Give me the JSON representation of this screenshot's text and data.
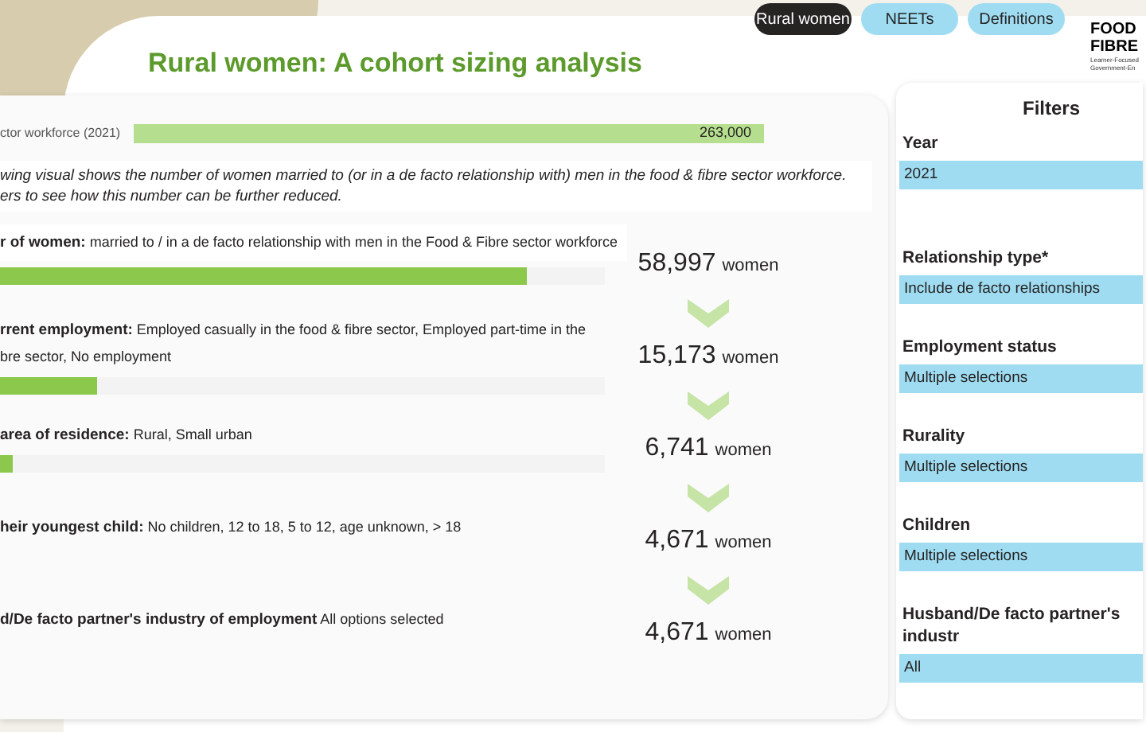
{
  "nav_buttons": [
    {
      "label": "Rural women",
      "selected": true
    },
    {
      "label": "NEETs",
      "selected": false
    },
    {
      "label": "Definitions",
      "selected": false
    }
  ],
  "title": "Rural women: A cohort sizing analysis",
  "logo": {
    "lines": [
      "FOOD",
      "FIBRE"
    ],
    "tagline": [
      "Learner-Focused",
      "Government-En"
    ]
  },
  "workforce": {
    "label": "ctor workforce (2021)",
    "value": "263,000"
  },
  "intro": [
    "wing visual shows the number of women married to (or in a de facto relationship with) men in the food & fibre sector workforce.",
    "ers to see how this number can be further reduced."
  ],
  "steps": [
    {
      "bold": "r of women:",
      "lines": [
        "married to / in a de facto relationship with men in the Food & Fibre sector workforce"
      ],
      "level": 0.87,
      "count": "58,997",
      "unit": "women"
    },
    {
      "bold": "rrent employment:",
      "lines": [
        "Employed casually in the food & fibre sector, Employed part-time in the",
        "bre sector, No employment"
      ],
      "level": 0.16,
      "count": "15,173",
      "unit": "women"
    },
    {
      "bold": "area of residence:",
      "lines": [
        "Rural, Small urban"
      ],
      "level": 0.02,
      "count": "6,741",
      "unit": "women"
    },
    {
      "bold": "heir youngest child:",
      "lines": [
        "No children, 12 to 18, 5 to 12, age unknown, > 18"
      ],
      "count": "4,671",
      "unit": "women"
    },
    {
      "bold": "d/De facto partner's industry of employment",
      "lines": [
        "All options selected"
      ],
      "count": "4,671",
      "unit": "women"
    }
  ],
  "filters": {
    "title": "Filters",
    "items": [
      {
        "label": "Year",
        "value": "2021"
      },
      {
        "label": "Relationship type*",
        "value": "Include de facto relationships"
      },
      {
        "label": "Employment status",
        "value": "Multiple selections"
      },
      {
        "label": "Rurality",
        "value": "Multiple selections"
      },
      {
        "label": "Children",
        "value": "Multiple selections"
      },
      {
        "label": "Husband/De facto partner's industr",
        "value": "All"
      }
    ]
  }
}
